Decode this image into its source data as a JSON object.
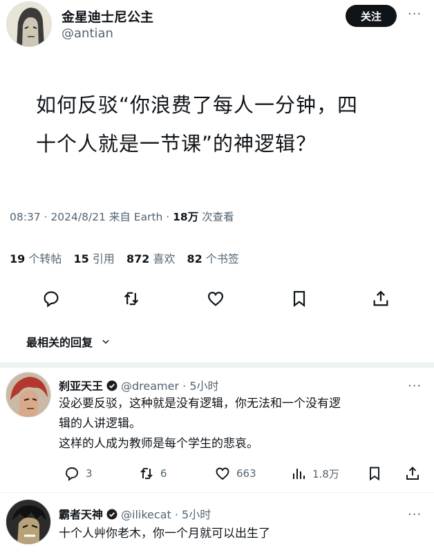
{
  "post": {
    "author_name": "金星迪士尼公主",
    "author_handle": "@antian",
    "follow_label": "关注",
    "text_line1": "如何反驳“你浪费了每人一分钟，四",
    "text_line2": "十个人就是一节课”的神逻辑？",
    "time": "08:37 · 2024/8/21 来自 Earth · ",
    "views_count": "18万",
    "views_label": " 次查看",
    "stats": [
      {
        "count": "19",
        "label": "个转帖"
      },
      {
        "count": "15",
        "label": "引用"
      },
      {
        "count": "872",
        "label": "喜欢"
      },
      {
        "count": "82",
        "label": "个书签"
      }
    ]
  },
  "actions": {
    "icons": [
      "reply-icon",
      "retweet-icon",
      "like-icon",
      "bookmark-icon",
      "share-icon"
    ]
  },
  "sort": {
    "label": "最相关的回复"
  },
  "replies": [
    {
      "name": "刹亚天王",
      "handle": "@dreamer · 5小时",
      "lines": [
        "没必要反驳，这种就是没有逻辑，你无法和一个没有逻",
        "辑的人讲逻辑。",
        "这样的人成为教师是每个学生的悲哀。"
      ],
      "replies": "3",
      "retweets": "6",
      "likes": "663",
      "views": "1.8万"
    },
    {
      "name": "霸者天神",
      "handle": "@ilikecat · 5小时",
      "lines": [
        "十个人艸你老木，你一个月就可以出生了"
      ]
    }
  ],
  "colors": {
    "text": "#0f1419",
    "secondary": "#536471",
    "verified": "#1d9bf0",
    "divider": "#eff3f4"
  }
}
